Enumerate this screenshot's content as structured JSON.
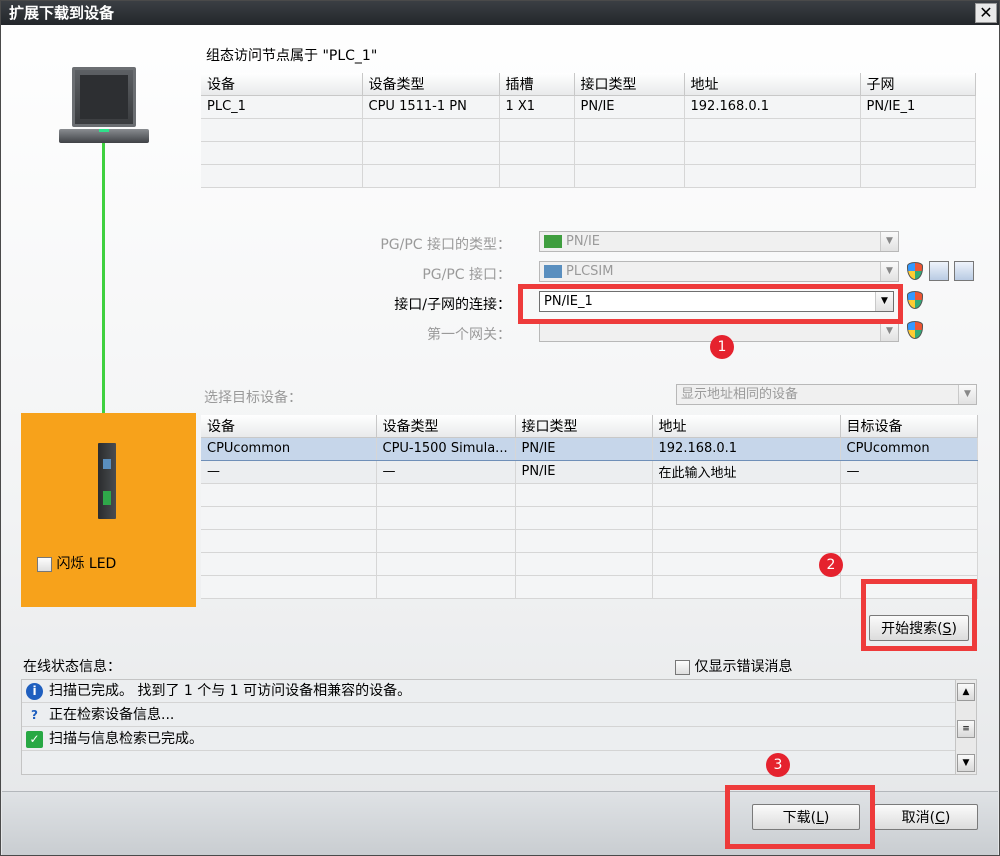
{
  "window": {
    "title": "扩展下载到设备",
    "close": "✕"
  },
  "config": {
    "heading": "组态访问节点属于 \"PLC_1\"",
    "columns": [
      "设备",
      "设备类型",
      "插槽",
      "接口类型",
      "地址",
      "子网"
    ],
    "rows": [
      [
        "PLC_1",
        "CPU 1511-1 PN",
        "1 X1",
        "PN/IE",
        "192.168.0.1",
        "PN/IE_1"
      ]
    ]
  },
  "form": {
    "pgpc_type_label": "PG/PC 接口的类型：",
    "pgpc_type_value": "PN/IE",
    "pgpc_if_label": "PG/PC 接口：",
    "pgpc_if_value": "PLCSIM",
    "subnet_label": "接口/子网的连接：",
    "subnet_value": "PN/IE_1",
    "gateway_label": "第一个网关："
  },
  "target": {
    "label": "选择目标设备：",
    "filter_value": "显示地址相同的设备",
    "columns": [
      "设备",
      "设备类型",
      "接口类型",
      "地址",
      "目标设备"
    ],
    "rows": [
      [
        "CPUcommon",
        "CPU-1500 Simula...",
        "PN/IE",
        "192.168.0.1",
        "CPUcommon"
      ],
      [
        "—",
        "—",
        "PN/IE",
        "在此输入地址",
        "—"
      ]
    ]
  },
  "flash_led": "闪烁 LED",
  "search_button": {
    "text": "开始搜索(",
    "key": "S",
    "end": ")"
  },
  "status": {
    "label": "在线状态信息：",
    "errors_only": "仅显示错误消息",
    "messages": [
      "扫描已完成。 找到了 1 个与 1 可访问设备相兼容的设备。",
      "正在检索设备信息...",
      "扫描与信息检索已完成。"
    ]
  },
  "buttons": {
    "download": {
      "text": "下载(",
      "key": "L",
      "end": ")"
    },
    "cancel": {
      "text": "取消(",
      "key": "C",
      "end": ")"
    }
  },
  "badges": [
    "1",
    "2",
    "3"
  ],
  "colors": {
    "highlight": "#ee3b3b",
    "badge": "#e5222e",
    "device_panel": "#f7a21b",
    "link": "#3fd13f"
  }
}
